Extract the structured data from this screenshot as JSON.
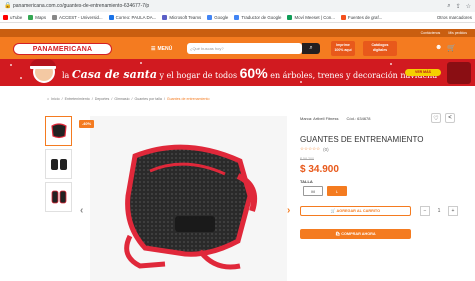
{
  "browser": {
    "url": "panamericana.com.co/guantes-de-entrenamiento-634677-7/p",
    "bookmarks": [
      {
        "label": "uTube",
        "color": "#ff0000"
      },
      {
        "label": "Maps",
        "color": "#34a853"
      },
      {
        "label": "ACCEST - Universid...",
        "color": "#888888"
      },
      {
        "label": "Correo: PAULA DA...",
        "color": "#1a73e8"
      },
      {
        "label": "Microsoft Teams",
        "color": "#5b5fc7"
      },
      {
        "label": "Google",
        "color": "#4285f4"
      },
      {
        "label": "Traductor de Google",
        "color": "#4285f4"
      },
      {
        "label": "Moví Meeset | Con...",
        "color": "#0f9d58"
      },
      {
        "label": "Fuentes de graf...",
        "color": "#f4511e"
      }
    ],
    "other_bookmarks": "Otros marcadores"
  },
  "header": {
    "top_links": [
      "Contáctenos",
      "Mis pedidos"
    ],
    "logo": "PANAMERICANA",
    "menu_label": "MENÚ",
    "search_placeholder": "¿Qué buscas hoy?",
    "search_icon": "search-icon",
    "promo_1": [
      "Imprime",
      "100% aquí"
    ],
    "promo_2": [
      "Catálogos",
      "digitales"
    ],
    "accent_color": "#f47b20"
  },
  "banner": {
    "part1": "la ",
    "highlight": "Casa de santa",
    "part2": " y el hogar de todos ",
    "pct": "60%",
    "part3": " en árboles, trenes y decoración navideña",
    "cta": "VER MÁS"
  },
  "breadcrumb": {
    "items": [
      "Inicio",
      "Entretenimiento",
      "Deportes",
      "Gimnasio",
      "Guantes por talla"
    ],
    "current": "Guantes de entrenamiento"
  },
  "gallery": {
    "badge": "-40%"
  },
  "product": {
    "brand": "Marca: Artbell Fitness",
    "code": "Cód.: 634678",
    "title": "GUANTES DE ENTRENAMIENTO",
    "stars": "☆☆☆☆☆",
    "reviews": "(0)",
    "old_price": "$ 58.200",
    "price": "$ 34.900",
    "size_label": "TALLA",
    "sizes": [
      "M",
      "L"
    ],
    "selected_size": "L",
    "add_to_cart": "AGREGAR AL CARRITO",
    "buy_now": "COMPRAR AHORA",
    "qty": "1",
    "minus": "−",
    "plus": "+"
  }
}
